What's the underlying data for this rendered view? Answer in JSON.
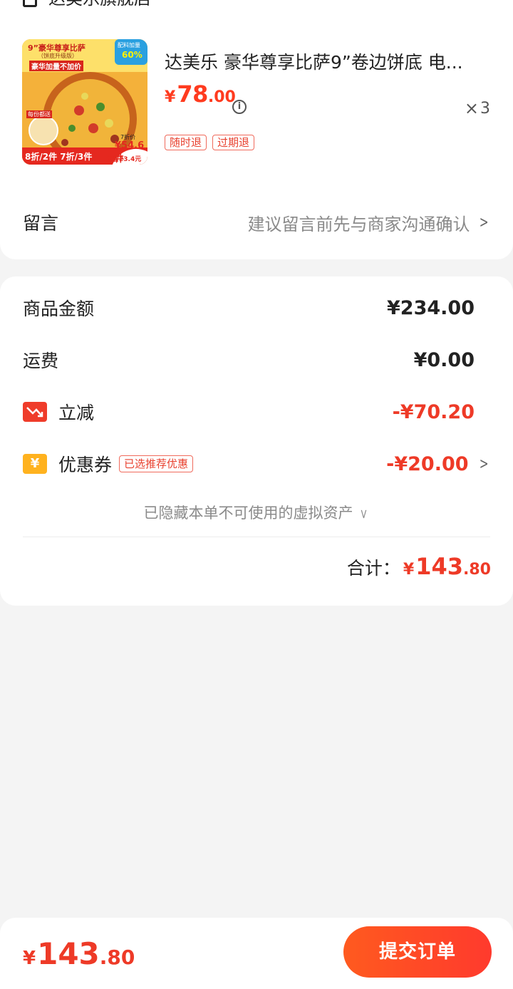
{
  "shop": {
    "name": "达美乐旗舰店"
  },
  "product": {
    "title": "达美乐 豪华尊享比萨9”卷边饼底 电...",
    "price": {
      "currency": "¥",
      "integer": "78",
      "decimal": ".00"
    },
    "quantity": "3",
    "quantity_prefix": "×",
    "tags": [
      "随时退",
      "过期退"
    ],
    "image": {
      "banner": "9”豪华尊享比萨",
      "sub": "（饼底升级版）",
      "ribbon": "豪华加量不加价",
      "badge_top": "配料加量",
      "badge_pct": "60%",
      "seven_off": "7折价",
      "price_tag": "¥54.6件",
      "promo": "8折/2件 7折/3件",
      "save": "立省23.4元",
      "extra": "每份都送"
    }
  },
  "message": {
    "label": "留言",
    "hint": "建议留言前先与商家沟通确认"
  },
  "summary": {
    "goods": {
      "label": "商品金额",
      "value": "¥234.00"
    },
    "shipping": {
      "label": "运费",
      "value": "¥0.00"
    },
    "discount": {
      "label": "立减",
      "value": "-¥70.20"
    },
    "coupon": {
      "label": "优惠券",
      "tag": "已选推荐优惠",
      "value": "-¥20.00"
    },
    "hidden_note": "已隐藏本单不可使用的虚拟资产",
    "total": {
      "label": "合计：",
      "currency": "¥",
      "integer": "143",
      "decimal": ".80"
    }
  },
  "bottom": {
    "currency": "¥",
    "integer": "143",
    "decimal": ".80",
    "submit_label": "提交订单"
  },
  "colors": {
    "accent": "#ee3a27",
    "button": "#ff4a22",
    "coupon_icon": "#ffb21e"
  }
}
